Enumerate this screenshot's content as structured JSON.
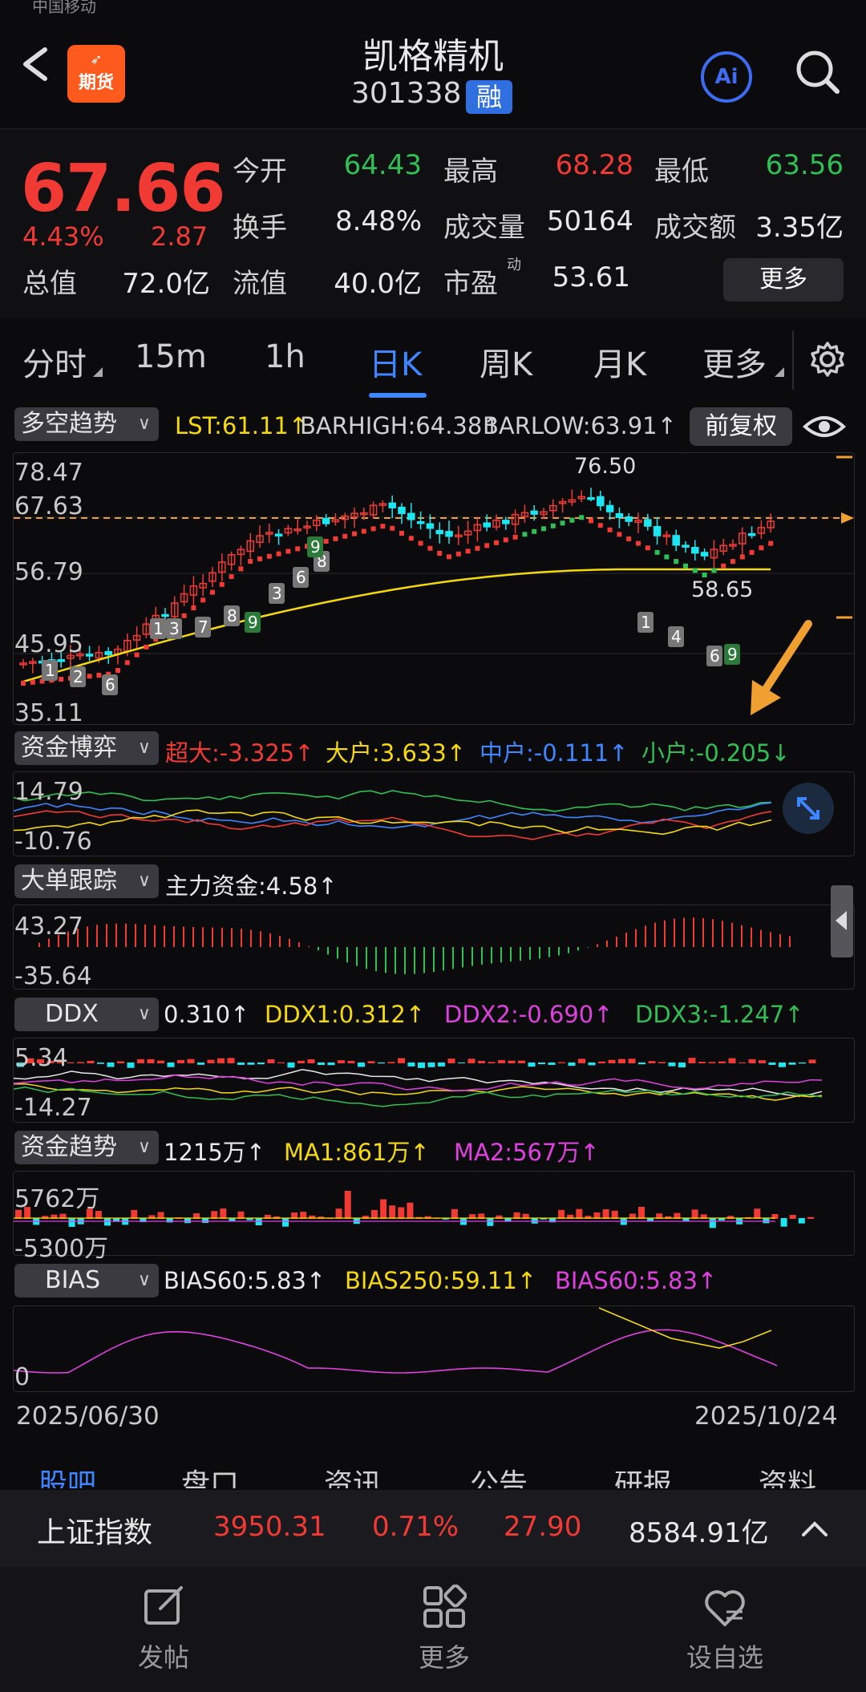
{
  "status": {
    "carrier": "中国移动"
  },
  "header": {
    "name": "凯格精机",
    "code": "301338",
    "rong_badge": "融",
    "logo_text": "期货",
    "ai_label": "Ai"
  },
  "quote": {
    "price": "67.66",
    "change_pct": "4.43%",
    "change": "2.87",
    "fields": [
      {
        "label": "今开",
        "value": "64.43",
        "color": "#2fbf55"
      },
      {
        "label": "最高",
        "value": "68.28",
        "color": "#f23a35"
      },
      {
        "label": "最低",
        "value": "63.56",
        "color": "#2fbf55"
      },
      {
        "label": "换手",
        "value": "8.48%",
        "color": "#e8e8e8"
      },
      {
        "label": "成交量",
        "value": "50164",
        "color": "#e8e8e8"
      },
      {
        "label": "成交额",
        "value": "3.35亿",
        "color": "#e8e8e8"
      },
      {
        "label": "总值",
        "value": "72.0亿",
        "color": "#e8e8e8"
      },
      {
        "label": "流值",
        "value": "40.0亿",
        "color": "#e8e8e8"
      },
      {
        "label": "市盈",
        "value": "53.61",
        "color": "#e8e8e8",
        "sup": "动"
      }
    ],
    "more": "更多"
  },
  "tabs": [
    "分时",
    "15m",
    "1h",
    "日K",
    "周K",
    "月K",
    "更多"
  ],
  "main_chart": {
    "indicator": "多空趋势",
    "lst": "LST:61.11↑",
    "barhigh": "BARHIGH:64.38↑",
    "barlow": "BARLOW:63.91↑",
    "fuquan": "前复权",
    "y_labels": [
      "78.47",
      "67.63",
      "56.79",
      "45.95",
      "35.11"
    ],
    "high_label": "76.50",
    "low_label": "58.65"
  },
  "capital_game": {
    "indicator": "资金博弈",
    "vals": [
      {
        "text": "超大:-3.325↑",
        "color": "#f23a35"
      },
      {
        "text": "大户:3.633↑",
        "color": "#f5d90a"
      },
      {
        "text": "中户:-0.111↑",
        "color": "#3d86ff"
      },
      {
        "text": "小户:-0.205↓",
        "color": "#2fbf55"
      }
    ],
    "y_top": "14.79",
    "y_bot": "-10.76"
  },
  "big_order": {
    "indicator": "大单跟踪",
    "main": "主力资金:4.58↑",
    "y_top": "43.27",
    "y_bot": "-35.64"
  },
  "ddx": {
    "indicator": "DDX",
    "vals": [
      {
        "text": "0.310↑",
        "color": "#e8e8e8"
      },
      {
        "text": "DDX1:0.312↑",
        "color": "#f5d90a"
      },
      {
        "text": "DDX2:-0.690↑",
        "color": "#e040e0"
      },
      {
        "text": "DDX3:-1.247↑",
        "color": "#2fbf55"
      }
    ],
    "y_top": "5.34",
    "y_bot": "-14.27"
  },
  "capital_trend": {
    "indicator": "资金趋势",
    "vals": [
      {
        "text": "1215万↑",
        "color": "#e8e8e8"
      },
      {
        "text": "MA1:861万↑",
        "color": "#f5d90a"
      },
      {
        "text": "MA2:567万↑",
        "color": "#e040e0"
      }
    ],
    "y_top": "5762万",
    "y_bot": "-5300万"
  },
  "bias": {
    "indicator": "BIAS",
    "vals": [
      {
        "text": "BIAS60:5.83↑",
        "color": "#e8e8e8"
      },
      {
        "text": "BIAS250:59.11↑",
        "color": "#f5d90a"
      },
      {
        "text": "BIAS60:5.83↑",
        "color": "#e040e0"
      }
    ],
    "y_bot": "0"
  },
  "dates": {
    "start": "2025/06/30",
    "end": "2025/10/24"
  },
  "subtabs": [
    "股吧",
    "盘口",
    "资讯",
    "公告",
    "研报",
    "资料"
  ],
  "index_bar": {
    "name": "上证指数",
    "value": "3950.31",
    "pct": "0.71%",
    "chg": "27.90",
    "amount": "8584.91亿"
  },
  "nav": [
    {
      "label": "发帖",
      "icon": "post-icon"
    },
    {
      "label": "更多",
      "icon": "grid-icon"
    },
    {
      "label": "设自选",
      "icon": "heart-icon"
    }
  ],
  "colors": {
    "up": "#f23a35",
    "down": "#2fbf55",
    "accent": "#3d86ff",
    "cyan": "#1ee6f0",
    "yellow": "#f5d90a"
  }
}
